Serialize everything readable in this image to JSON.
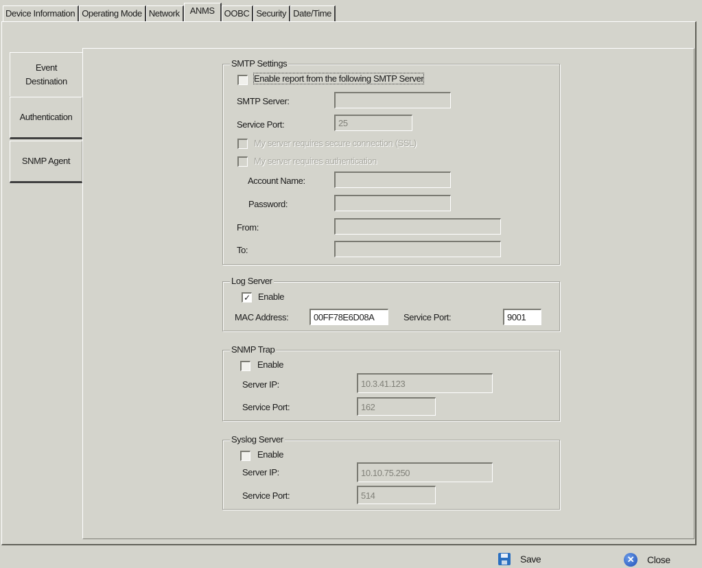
{
  "top_tabs": [
    {
      "label": "Device Information",
      "active": false
    },
    {
      "label": "Operating Mode",
      "active": false
    },
    {
      "label": "Network",
      "active": false
    },
    {
      "label": "ANMS",
      "active": true
    },
    {
      "label": "OOBC",
      "active": false
    },
    {
      "label": "Security",
      "active": false
    },
    {
      "label": "Date/Time",
      "active": false
    }
  ],
  "side_tabs": [
    {
      "label": "Event\nDestination",
      "active": true
    },
    {
      "label": "Authentication",
      "active": false
    },
    {
      "label": "SNMP Agent",
      "active": false
    }
  ],
  "smtp": {
    "title": "SMTP Settings",
    "enable_label": "Enable report  from the following SMTP Server",
    "enable_checked": false,
    "server_label": "SMTP Server:",
    "server_value": "",
    "port_label": "Service Port:",
    "port_value": "25",
    "ssl_label": "My server requires secure connection (SSL)",
    "auth_label": "My server requires authentication",
    "account_label": "Account Name:",
    "account_value": "",
    "password_label": "Password:",
    "password_value": "",
    "from_label": "From:",
    "from_value": "",
    "to_label": "To:",
    "to_value": ""
  },
  "log_server": {
    "title": "Log Server",
    "enable_label": "Enable",
    "enable_checked": true,
    "check_glyph": "✓",
    "mac_label": "MAC Address:",
    "mac_value": "00FF78E6D08A",
    "port_label": "Service Port:",
    "port_value": "9001"
  },
  "snmp_trap": {
    "title": "SNMP Trap",
    "enable_label": "Enable",
    "enable_checked": false,
    "ip_label": "Server IP:",
    "ip_value": "10.3.41.123",
    "port_label": "Service Port:",
    "port_value": "162"
  },
  "syslog": {
    "title": "Syslog Server",
    "enable_label": "Enable",
    "enable_checked": false,
    "ip_label": "Server IP:",
    "ip_value": "10.10.75.250",
    "port_label": "Service Port:",
    "port_value": "514"
  },
  "footer": {
    "save_label": "Save",
    "close_label": "Close",
    "close_glyph": "✕"
  }
}
